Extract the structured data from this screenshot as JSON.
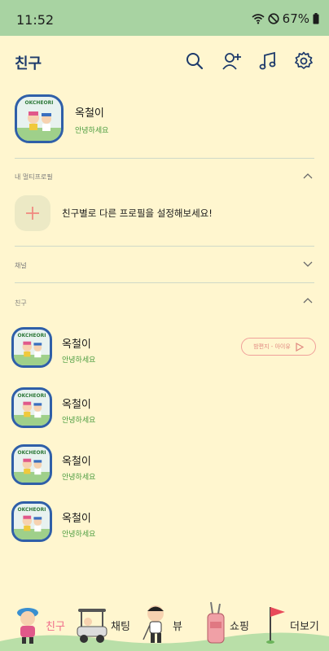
{
  "status_bar": {
    "time": "11:52",
    "battery": "67%"
  },
  "header": {
    "title": "친구"
  },
  "my_profile": {
    "name": "옥철이",
    "status": "안녕하세요",
    "avatar_tag": "OKCHEORI"
  },
  "multi_profile": {
    "section_label": "내 멀티프로필",
    "prompt": "친구별로 다른 프로필을 설정해보세요!"
  },
  "channel": {
    "section_label": "채널"
  },
  "friends": {
    "section_label": "친구",
    "items": [
      {
        "name": "옥철이",
        "status": "안녕하세요",
        "avatar_tag": "OKCHEORI",
        "music": "밤편지 - 아이유"
      },
      {
        "name": "옥철이",
        "status": "안녕하세요",
        "avatar_tag": "OKCHEORI"
      },
      {
        "name": "옥철이",
        "status": "안녕하세요",
        "avatar_tag": "OKCHEORI"
      },
      {
        "name": "옥철이",
        "status": "안녕하세요",
        "avatar_tag": "OKCHEORI"
      }
    ]
  },
  "tabs": [
    {
      "label": "친구",
      "icon": "golfer-character-icon",
      "color": "#f06b8a"
    },
    {
      "label": "채팅",
      "icon": "golf-cart-icon",
      "color": "#2a2a2a"
    },
    {
      "label": "뷰",
      "icon": "character-swing-icon",
      "color": "#2a2a2a"
    },
    {
      "label": "쇼핑",
      "icon": "golf-bag-icon",
      "color": "#2a2a2a"
    },
    {
      "label": "더보기",
      "icon": "flag-icon",
      "color": "#2a2a2a"
    }
  ],
  "colors": {
    "background": "#fff6cf",
    "status_bar": "#a8d3a2",
    "accent_pink": "#f06b8a",
    "header_blue": "#1d3a6b"
  }
}
